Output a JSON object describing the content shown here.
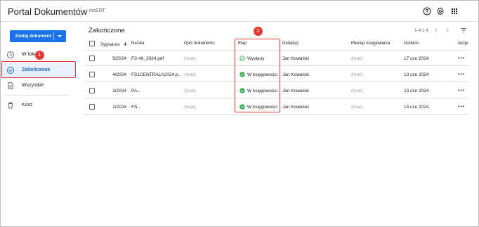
{
  "header": {
    "app_title": "Portal Dokumentów",
    "organization": "insERT",
    "icons": [
      "help-icon",
      "settings-icon",
      "apps-grid-icon"
    ]
  },
  "sidebar": {
    "add_button_label": "Dodaj dokument",
    "items": [
      {
        "label": "W toku",
        "icon": "clock-icon",
        "active": false
      },
      {
        "label": "Zakończone",
        "icon": "check-circle-icon",
        "active": true
      },
      {
        "label": "Wszystkie",
        "icon": "documents-icon",
        "active": false
      },
      {
        "label": "Kosz",
        "icon": "trash-icon",
        "active": false
      }
    ]
  },
  "main": {
    "title": "Zakończone",
    "pagination": "1-4 z 4"
  },
  "annotations": {
    "badge1": "1",
    "badge2": "2"
  },
  "colors": {
    "accent": "#1a73e8",
    "success": "#34a853",
    "highlight": "#e53935"
  },
  "table": {
    "headers": {
      "signature": "Sygnatura",
      "name": "Nazwa",
      "description": "Opis dokumentu",
      "stage": "Etap",
      "added_by": "Dodał(a)",
      "month": "Miesiąc księgowania",
      "added": "Dodano",
      "actions": "Akcje"
    },
    "rows": [
      {
        "signature": "5/2024",
        "name": "FS 46_2024.pdf",
        "description": "(brak)",
        "stage": "Wysłany",
        "added_by": "Jan Kowalski",
        "month": "(brak)",
        "added": "17 cze 2024",
        "actions": "•••"
      },
      {
        "signature": "4/2024",
        "name": "FS1CENTRALA2024.p...",
        "description": "(brak)",
        "stage": "W księgowości",
        "added_by": "Jan Kowalski",
        "month": "(brak)",
        "added": "13 cze 2024",
        "actions": "•••"
      },
      {
        "signature": "3/2024",
        "name": "PA...",
        "description": "(brak)",
        "stage": "W księgowości",
        "added_by": "Jan Kowalski",
        "month": "(brak)",
        "added": "13 cze 2024",
        "actions": "•••"
      },
      {
        "signature": "2/2024",
        "name": "FS...",
        "description": "(brak)",
        "stage": "W księgowości",
        "added_by": "Jan Kowalski",
        "month": "(brak)",
        "added": "13 cze 2024",
        "actions": "•••"
      }
    ]
  }
}
